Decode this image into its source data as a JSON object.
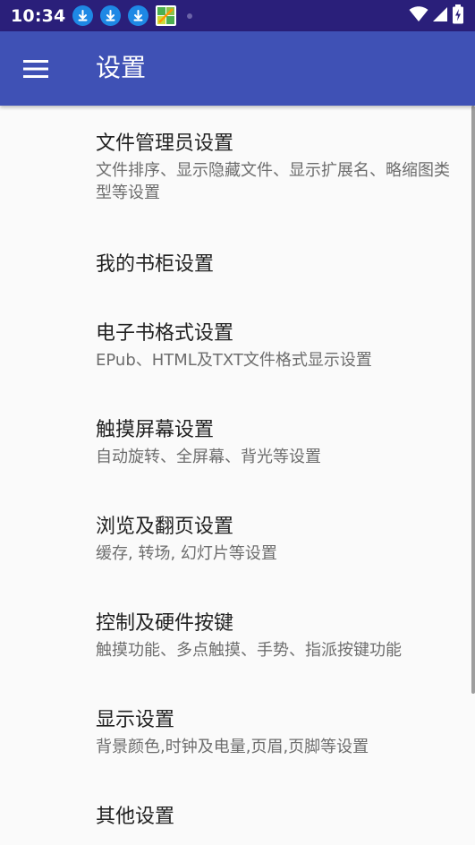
{
  "status_bar": {
    "time": "10:34",
    "notifications": [
      "download-icon",
      "download-icon",
      "download-icon",
      "game-app-icon",
      "dot-icon"
    ],
    "status_icons": [
      "wifi-icon",
      "cell-signal-icon",
      "battery-charging-icon"
    ],
    "colors": {
      "background": "#2a1f7a",
      "download_badge": "#1e88e5"
    }
  },
  "app_bar": {
    "title": "设置",
    "nav_icon": "hamburger-menu-icon",
    "color": "#3f51b5"
  },
  "settings": [
    {
      "title": "文件管理员设置",
      "summary": "文件排序、显示隐藏文件、显示扩展名、略缩图类型等设置"
    },
    {
      "title": "我的书柜设置",
      "summary": ""
    },
    {
      "title": "电子书格式设置",
      "summary": "EPub、HTML及TXT文件格式显示设置"
    },
    {
      "title": "触摸屏幕设置",
      "summary": "自动旋转、全屏幕、背光等设置"
    },
    {
      "title": "浏览及翻页设置",
      "summary": "缓存, 转场, 幻灯片等设置"
    },
    {
      "title": "控制及硬件按键",
      "summary": "触摸功能、多点触摸、手势、指派按键功能"
    },
    {
      "title": "显示设置",
      "summary": "背景颜色,时钟及电量,页眉,页脚等设置"
    },
    {
      "title": "其他设置",
      "summary": ""
    }
  ]
}
